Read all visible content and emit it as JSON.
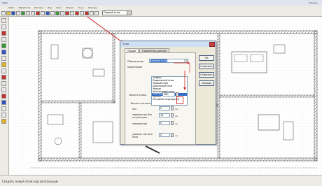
{
  "app": {
    "title_left": "Файл",
    "title_right": "Помощь"
  },
  "menu": [
    "Файл",
    "Обработка",
    "Вставка",
    "Вид",
    "Окна",
    "Объект",
    "Окно",
    "Помощь"
  ],
  "toolbar": {
    "floor_combo_value": "Первый этаж"
  },
  "status": {
    "text": "Создать новый этаж над актуальным"
  },
  "dialog": {
    "title": "Этаж",
    "tabs": [
      "Общие",
      "Параметры данных"
    ],
    "labels": {
      "designation": "Обозначение",
      "note": "примечание",
      "floor_height": "Высота этажа",
      "ceiling_section": "Высота потолка",
      "floor": "пол",
      "ceiling_overlap": "перекрытие без штукатурки",
      "overlap_full": "перекрытие",
      "floor_level": "уровень чистого пола"
    },
    "designation_value": "Первый этаж",
    "options": [
      "Подвал",
      "Подвальный этаж",
      "Первый этаж",
      "Цокольный этаж",
      "Чердак",
      "Мансардный этаж",
      "Мансардный этаж",
      "Крыша",
      "Непрямая перекрытие"
    ],
    "selected_index": 6,
    "floor_height_value": "280",
    "values": {
      "floor": "0",
      "ceiling": "16",
      "overlap": "0",
      "level": "0"
    },
    "unit": "см",
    "buttons": {
      "ok": "ОК",
      "cancel": "Отменить",
      "apply": "Отменить",
      "help": "Помощь"
    }
  }
}
